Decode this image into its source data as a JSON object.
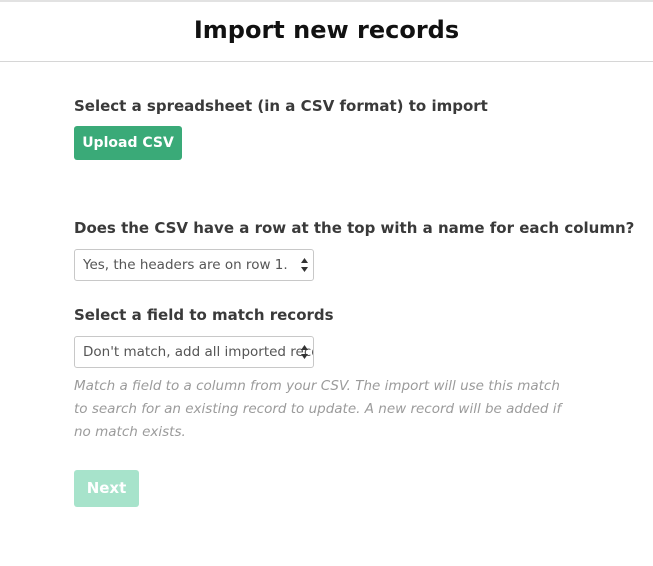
{
  "header": {
    "title": "Import new records"
  },
  "upload": {
    "label": "Select a spreadsheet (in a CSV format) to import",
    "button_label": "Upload CSV"
  },
  "headers_question": {
    "label": "Does the CSV have a row at the top with a name for each column?",
    "selected": "Yes, the headers are on row 1."
  },
  "match_field": {
    "label": "Select a field to match records",
    "selected": "Don't match, add all imported records",
    "help": "Match a field to a column from your CSV. The import will use this match to search for an existing record to update. A new record will be added if no match exists."
  },
  "next_button": {
    "label": "Next",
    "disabled": true
  },
  "colors": {
    "primary": "#3aaa78",
    "primary_disabled": "#a7e3cb",
    "help_text": "#9b9b9b"
  },
  "icons": {
    "select_arrows": "up-down-arrows-icon"
  }
}
